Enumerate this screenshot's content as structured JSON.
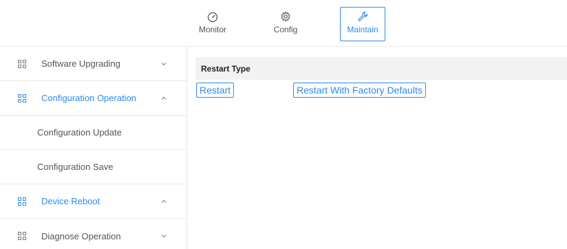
{
  "nav": {
    "monitor_label": "Monitor",
    "config_label": "Config",
    "maintain_label": "Maintain"
  },
  "sidebar": {
    "software_upgrading": "Software Upgrading",
    "configuration_operation": "Configuration Operation",
    "configuration_update": "Configuration Update",
    "configuration_save": "Configuration Save",
    "device_reboot": "Device Reboot",
    "diagnose_operation": "Diagnose Operation"
  },
  "content": {
    "header": "Restart Type",
    "restart_label": "Restart",
    "factory_label": "Restart With Factory Defaults"
  },
  "colors": {
    "accent": "#2d8cf0",
    "text": "#555555",
    "header_bg": "#f2f2f2"
  },
  "icons": {
    "monitor": "gauge-icon",
    "config": "gear-icon",
    "maintain": "wrench-icon",
    "sidebar_item": "grid-icon"
  }
}
